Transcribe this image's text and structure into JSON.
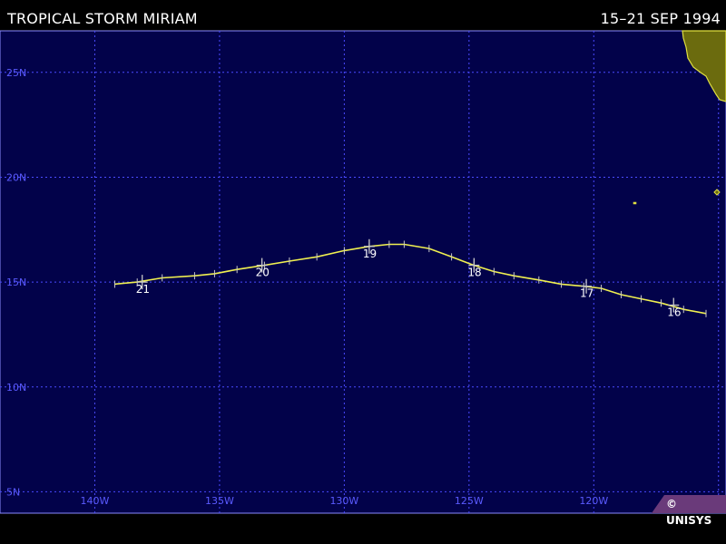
{
  "header": {
    "title": "TROPICAL STORM MIRIAM",
    "dates": "15–21 SEP 1994"
  },
  "credit": "© UNISYS",
  "colors": {
    "ocean": "#02024a",
    "grid": "#4a4aff",
    "axis_label": "#5a5aff",
    "track": "#f0f050",
    "marker": "#c8c8c8",
    "day_label": "#ffffff",
    "land": "#6b6b0e",
    "coast": "#e0e040",
    "credit_bg": "#6a3a7a"
  },
  "map": {
    "lon_range": [
      -143.8,
      -114.7
    ],
    "lat_range": [
      3.98,
      26.98
    ],
    "lon_ticks": [
      {
        "value": -140,
        "label": "140W"
      },
      {
        "value": -135,
        "label": "135W"
      },
      {
        "value": -130,
        "label": "130W"
      },
      {
        "value": -125,
        "label": "125W"
      },
      {
        "value": -120,
        "label": "120W"
      },
      {
        "value": -115,
        "label": "115W"
      }
    ],
    "lat_ticks": [
      {
        "value": 25,
        "label": "25N"
      },
      {
        "value": 20,
        "label": "20N"
      },
      {
        "value": 15,
        "label": "15N"
      },
      {
        "value": 10,
        "label": "10N"
      },
      {
        "value": 5,
        "label": "5N"
      }
    ]
  },
  "storm": {
    "track": [
      [
        -115.5,
        13.5
      ],
      [
        -116.4,
        13.7
      ],
      [
        -117.3,
        14.0
      ],
      [
        -118.1,
        14.2
      ],
      [
        -118.9,
        14.4
      ],
      [
        -119.7,
        14.7
      ],
      [
        -120.4,
        14.8
      ],
      [
        -121.3,
        14.9
      ],
      [
        -122.2,
        15.1
      ],
      [
        -123.2,
        15.3
      ],
      [
        -124.0,
        15.5
      ],
      [
        -124.8,
        15.8
      ],
      [
        -125.7,
        16.2
      ],
      [
        -126.6,
        16.6
      ],
      [
        -127.6,
        16.8
      ],
      [
        -128.2,
        16.8
      ],
      [
        -129.0,
        16.7
      ],
      [
        -130.0,
        16.5
      ],
      [
        -131.1,
        16.2
      ],
      [
        -132.2,
        16.0
      ],
      [
        -133.2,
        15.8
      ],
      [
        -134.3,
        15.6
      ],
      [
        -135.2,
        15.4
      ],
      [
        -136.0,
        15.3
      ],
      [
        -137.3,
        15.2
      ],
      [
        -138.3,
        15.0
      ],
      [
        -139.2,
        14.9
      ]
    ],
    "day_markers": [
      {
        "lon": -116.8,
        "lat": 13.9,
        "label": "16"
      },
      {
        "lon": -120.3,
        "lat": 14.8,
        "label": "17"
      },
      {
        "lon": -124.8,
        "lat": 15.8,
        "label": "18"
      },
      {
        "lon": -129.0,
        "lat": 16.7,
        "label": "19"
      },
      {
        "lon": -133.3,
        "lat": 15.8,
        "label": "20"
      },
      {
        "lon": -138.1,
        "lat": 15.0,
        "label": "21"
      }
    ]
  }
}
